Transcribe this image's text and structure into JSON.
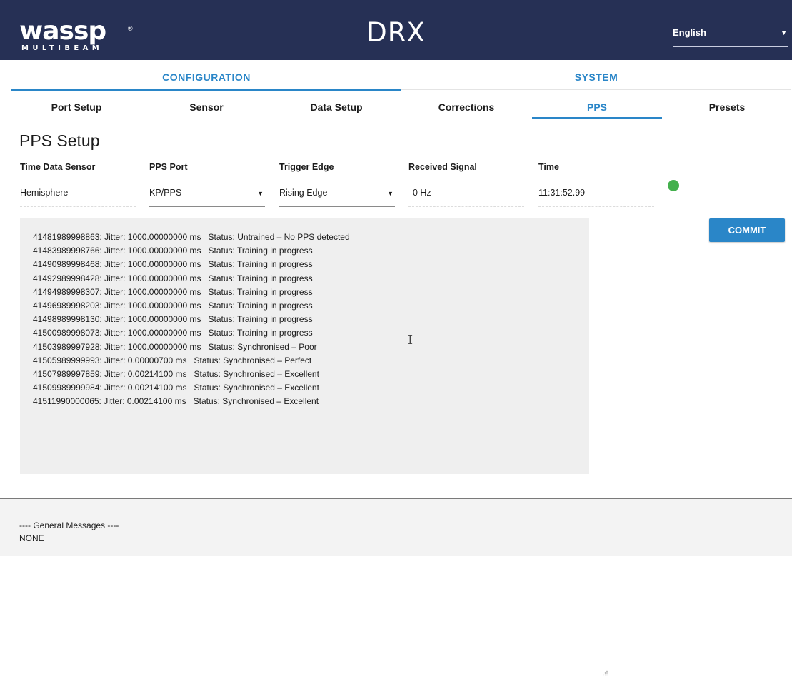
{
  "header": {
    "logo_text": "wassp",
    "logo_sub": "MULTIBEAM",
    "logo_mark": "®",
    "product": "DRX",
    "language": "English"
  },
  "main_tabs": [
    {
      "label": "CONFIGURATION",
      "active": true
    },
    {
      "label": "SYSTEM",
      "active": false
    }
  ],
  "sub_tabs": [
    {
      "label": "Port Setup"
    },
    {
      "label": "Sensor"
    },
    {
      "label": "Data Setup"
    },
    {
      "label": "Corrections"
    },
    {
      "label": "PPS",
      "active": true
    },
    {
      "label": "Presets"
    }
  ],
  "page_title": "PPS Setup",
  "fields": {
    "time_data_sensor": {
      "label": "Time Data Sensor",
      "value": "Hemisphere"
    },
    "pps_port": {
      "label": "PPS Port",
      "value": "KP/PPS"
    },
    "trigger_edge": {
      "label": "Trigger Edge",
      "value": "Rising Edge"
    },
    "received_signal": {
      "label": "Received Signal",
      "value": "0 Hz"
    },
    "time": {
      "label": "Time",
      "value": "11:31:52.99"
    }
  },
  "status_color": "#44b04d",
  "commit_label": "COMMIT",
  "log_lines": [
    "41481989998863: Jitter: 1000.00000000 ms   Status: Untrained – No PPS detected",
    "41483989998766: Jitter: 1000.00000000 ms   Status: Training in progress",
    "41490989998468: Jitter: 1000.00000000 ms   Status: Training in progress",
    "41492989998428: Jitter: 1000.00000000 ms   Status: Training in progress",
    "41494989998307: Jitter: 1000.00000000 ms   Status: Training in progress",
    "41496989998203: Jitter: 1000.00000000 ms   Status: Training in progress",
    "41498989998130: Jitter: 1000.00000000 ms   Status: Training in progress",
    "41500989998073: Jitter: 1000.00000000 ms   Status: Training in progress",
    "41503989997928: Jitter: 1000.00000000 ms   Status: Synchronised – Poor",
    "41505989999993: Jitter: 0.00000700 ms   Status: Synchronised – Perfect",
    "41507989997859: Jitter: 0.00214100 ms   Status: Synchronised – Excellent",
    "41509989999984: Jitter: 0.00214100 ms   Status: Synchronised – Excellent",
    "41511990000065: Jitter: 0.00214100 ms   Status: Synchronised – Excellent"
  ],
  "footer": {
    "heading": "---- General Messages ----",
    "message": "NONE"
  }
}
